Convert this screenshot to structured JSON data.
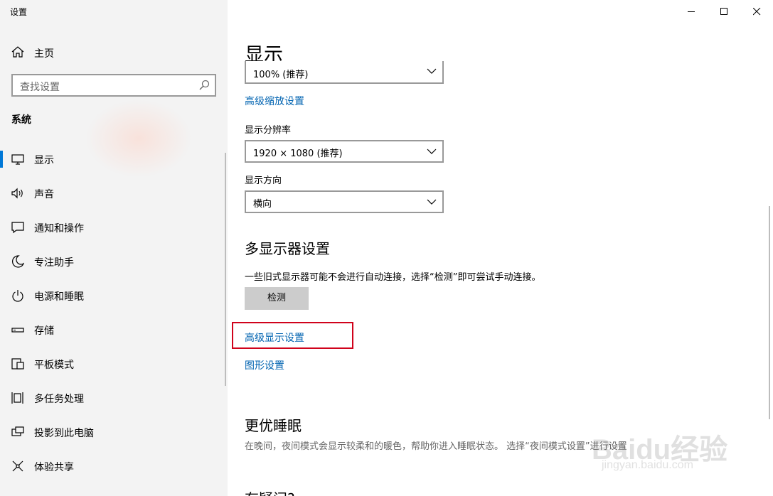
{
  "window": {
    "title": "设置"
  },
  "sidebar": {
    "home_label": "主页",
    "search_placeholder": "查找设置",
    "section_title": "系统",
    "items": [
      {
        "label": "显示",
        "icon": "monitor-icon",
        "active": true
      },
      {
        "label": "声音",
        "icon": "speaker-icon"
      },
      {
        "label": "通知和操作",
        "icon": "notification-icon"
      },
      {
        "label": "专注助手",
        "icon": "moon-icon"
      },
      {
        "label": "电源和睡眠",
        "icon": "power-icon"
      },
      {
        "label": "存储",
        "icon": "storage-icon"
      },
      {
        "label": "平板模式",
        "icon": "tablet-icon"
      },
      {
        "label": "多任务处理",
        "icon": "multitask-icon"
      },
      {
        "label": "投影到此电脑",
        "icon": "project-icon"
      },
      {
        "label": "体验共享",
        "icon": "share-icon"
      }
    ]
  },
  "main": {
    "page_title": "显示",
    "scale_value": "100% (推荐)",
    "advanced_scaling_link": "高级缩放设置",
    "resolution_label": "显示分辨率",
    "resolution_value": "1920 × 1080 (推荐)",
    "orientation_label": "显示方向",
    "orientation_value": "横向",
    "multi_display_heading": "多显示器设置",
    "multi_display_desc": "一些旧式显示器可能不会进行自动连接，选择“检测”即可尝试手动连接。",
    "detect_button": "检测",
    "advanced_display_link": "高级显示设置",
    "graphics_link": "图形设置",
    "sleep_heading": "更优睡眠",
    "sleep_desc": "在晚间，夜间模式会显示较柔和的暖色，帮助你进入睡眠状态。 选择“夜间模式设置”进行设置",
    "next_heading": "有疑问?"
  },
  "watermark": {
    "brand": "Baidu经验",
    "url": "jingyan.baidu.com"
  },
  "colors": {
    "accent": "#0078d7",
    "link": "#0063b1",
    "highlight": "#d0021b",
    "sidebar_bg": "#f3f3f3"
  }
}
